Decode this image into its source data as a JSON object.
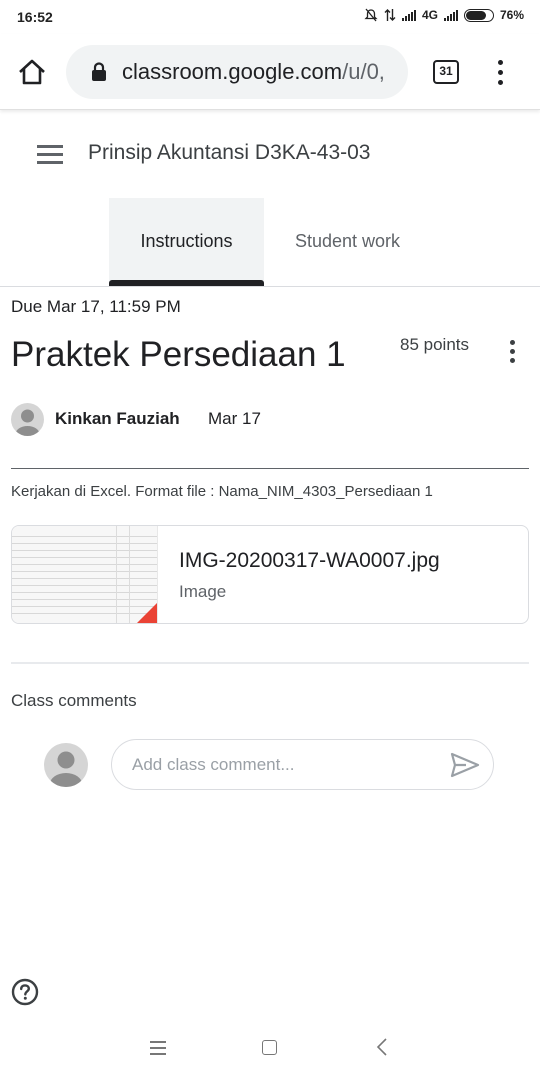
{
  "status_bar": {
    "time": "16:52",
    "network_label": "4G",
    "battery_percent": "76%",
    "battery_level": 0.76
  },
  "browser": {
    "url_host": "classroom.google.com",
    "url_path": "/u/0,",
    "tab_count": "31",
    "icons": [
      "home-icon",
      "lock-icon",
      "tab-switcher-icon",
      "more-vert-icon"
    ]
  },
  "app_bar": {
    "class_name": "Prinsip Akuntansi D3KA-43-03"
  },
  "tabs": [
    {
      "label": "Instructions",
      "active": true
    },
    {
      "label": "Student work",
      "active": false
    }
  ],
  "assignment": {
    "due": "Due Mar 17, 11:59 PM",
    "title": "Praktek Persediaan 1",
    "points": "85 points",
    "author": "Kinkan Fauziah",
    "date": "Mar 17",
    "description": "Kerjakan di Excel. Format file : Nama_NIM_4303_Persediaan 1"
  },
  "attachment": {
    "file_name": "IMG-20200317-WA0007.jpg",
    "file_type": "Image"
  },
  "comments": {
    "heading": "Class comments",
    "placeholder": "Add class comment..."
  },
  "colors": {
    "text_primary": "#202124",
    "text_secondary": "#5f6368",
    "tab_active_bg": "#f1f3f4",
    "divider": "#dadce0",
    "attachment_corner": "#ea4335"
  }
}
